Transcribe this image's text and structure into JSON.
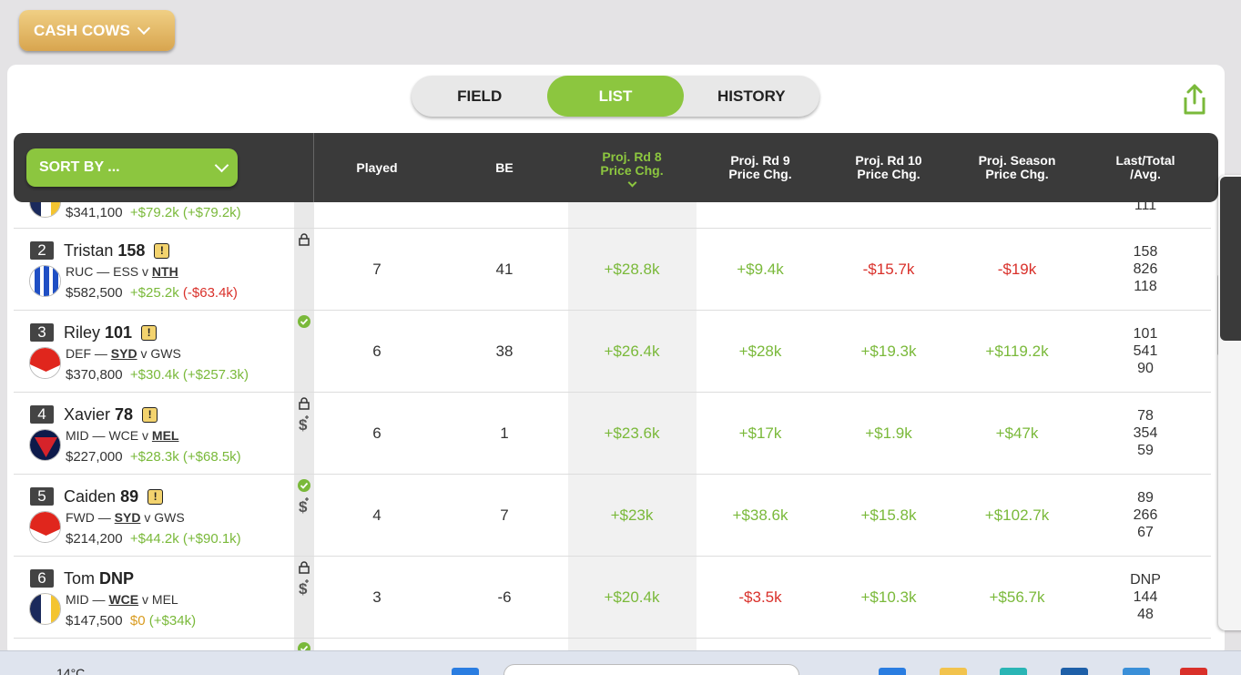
{
  "cash_cows": {
    "label": "CASH COWS"
  },
  "tabs": [
    {
      "label": "FIELD",
      "active": false
    },
    {
      "label": "LIST",
      "active": true
    },
    {
      "label": "HISTORY",
      "active": false
    }
  ],
  "sort": {
    "label": "SORT BY ..."
  },
  "columns": {
    "played": "Played",
    "be": "BE",
    "rd8_line1": "Proj. Rd 8",
    "rd8_line2": "Price Chg.",
    "rd9_line1": "Proj. Rd 9",
    "rd9_line2": "Price Chg.",
    "rd10_line1": "Proj. Rd 10",
    "rd10_line2": "Price Chg.",
    "season_line1": "Proj. Season",
    "season_line2": "Price Chg.",
    "last_line1": "Last/Total",
    "last_line2": "/Avg."
  },
  "partial_row": {
    "price": "$341,100",
    "chg": "+$79.2k",
    "chg_total": "(+$79.2k)",
    "avg": "111"
  },
  "players": [
    {
      "rank": "2",
      "first": "Tristan",
      "last": "158",
      "pos": "RUC",
      "team": "ESS",
      "opp": "NTH",
      "price": "$582,500",
      "chg": "+$25.2k",
      "chg_total": "(-$63.4k)",
      "played": "7",
      "be": "41",
      "rd8": "+$28.8k",
      "rd9": "+$9.4k",
      "rd10": "-$15.7k",
      "season": "-$19k",
      "total": "826",
      "avg": "118"
    },
    {
      "rank": "3",
      "first": "Riley",
      "last": "101",
      "pos": "DEF",
      "team": "SYD",
      "opp": "GWS",
      "price": "$370,800",
      "chg": "+$30.4k",
      "chg_total": "(+$257.3k)",
      "played": "6",
      "be": "38",
      "rd8": "+$26.4k",
      "rd9": "+$28k",
      "rd10": "+$19.3k",
      "season": "+$119.2k",
      "total": "541",
      "avg": "90"
    },
    {
      "rank": "4",
      "first": "Xavier",
      "last": "78",
      "pos": "MID",
      "team": "WCE",
      "opp": "MEL",
      "price": "$227,000",
      "chg": "+$28.3k",
      "chg_total": "(+$68.5k)",
      "played": "6",
      "be": "1",
      "rd8": "+$23.6k",
      "rd9": "+$17k",
      "rd10": "+$1.9k",
      "season": "+$47k",
      "total": "354",
      "avg": "59"
    },
    {
      "rank": "5",
      "first": "Caiden",
      "last": "89",
      "pos": "FWD",
      "team": "SYD",
      "opp": "GWS",
      "price": "$214,200",
      "chg": "+$44.2k",
      "chg_total": "(+$90.1k)",
      "played": "4",
      "be": "7",
      "rd8": "+$23k",
      "rd9": "+$38.6k",
      "rd10": "+$15.8k",
      "season": "+$102.7k",
      "total": "266",
      "avg": "67"
    },
    {
      "rank": "6",
      "first": "Tom",
      "last": "DNP",
      "pos": "MID",
      "team": "WCE",
      "opp": "MEL",
      "price": "$147,500",
      "chg": "$0",
      "chg_total": "(+$34k)",
      "played": "3",
      "be": "-6",
      "rd8": "+$20.4k",
      "rd9": "-$3.5k",
      "rd10": "+$10.3k",
      "season": "+$56.7k",
      "total": "144",
      "avg": "48"
    }
  ],
  "taskbar": {
    "temperature": "14°C"
  },
  "colors": {
    "accent_green": "#8cc63f",
    "gold": "#d8a54f",
    "negative": "#d9302a",
    "header": "#3a3a3a"
  }
}
